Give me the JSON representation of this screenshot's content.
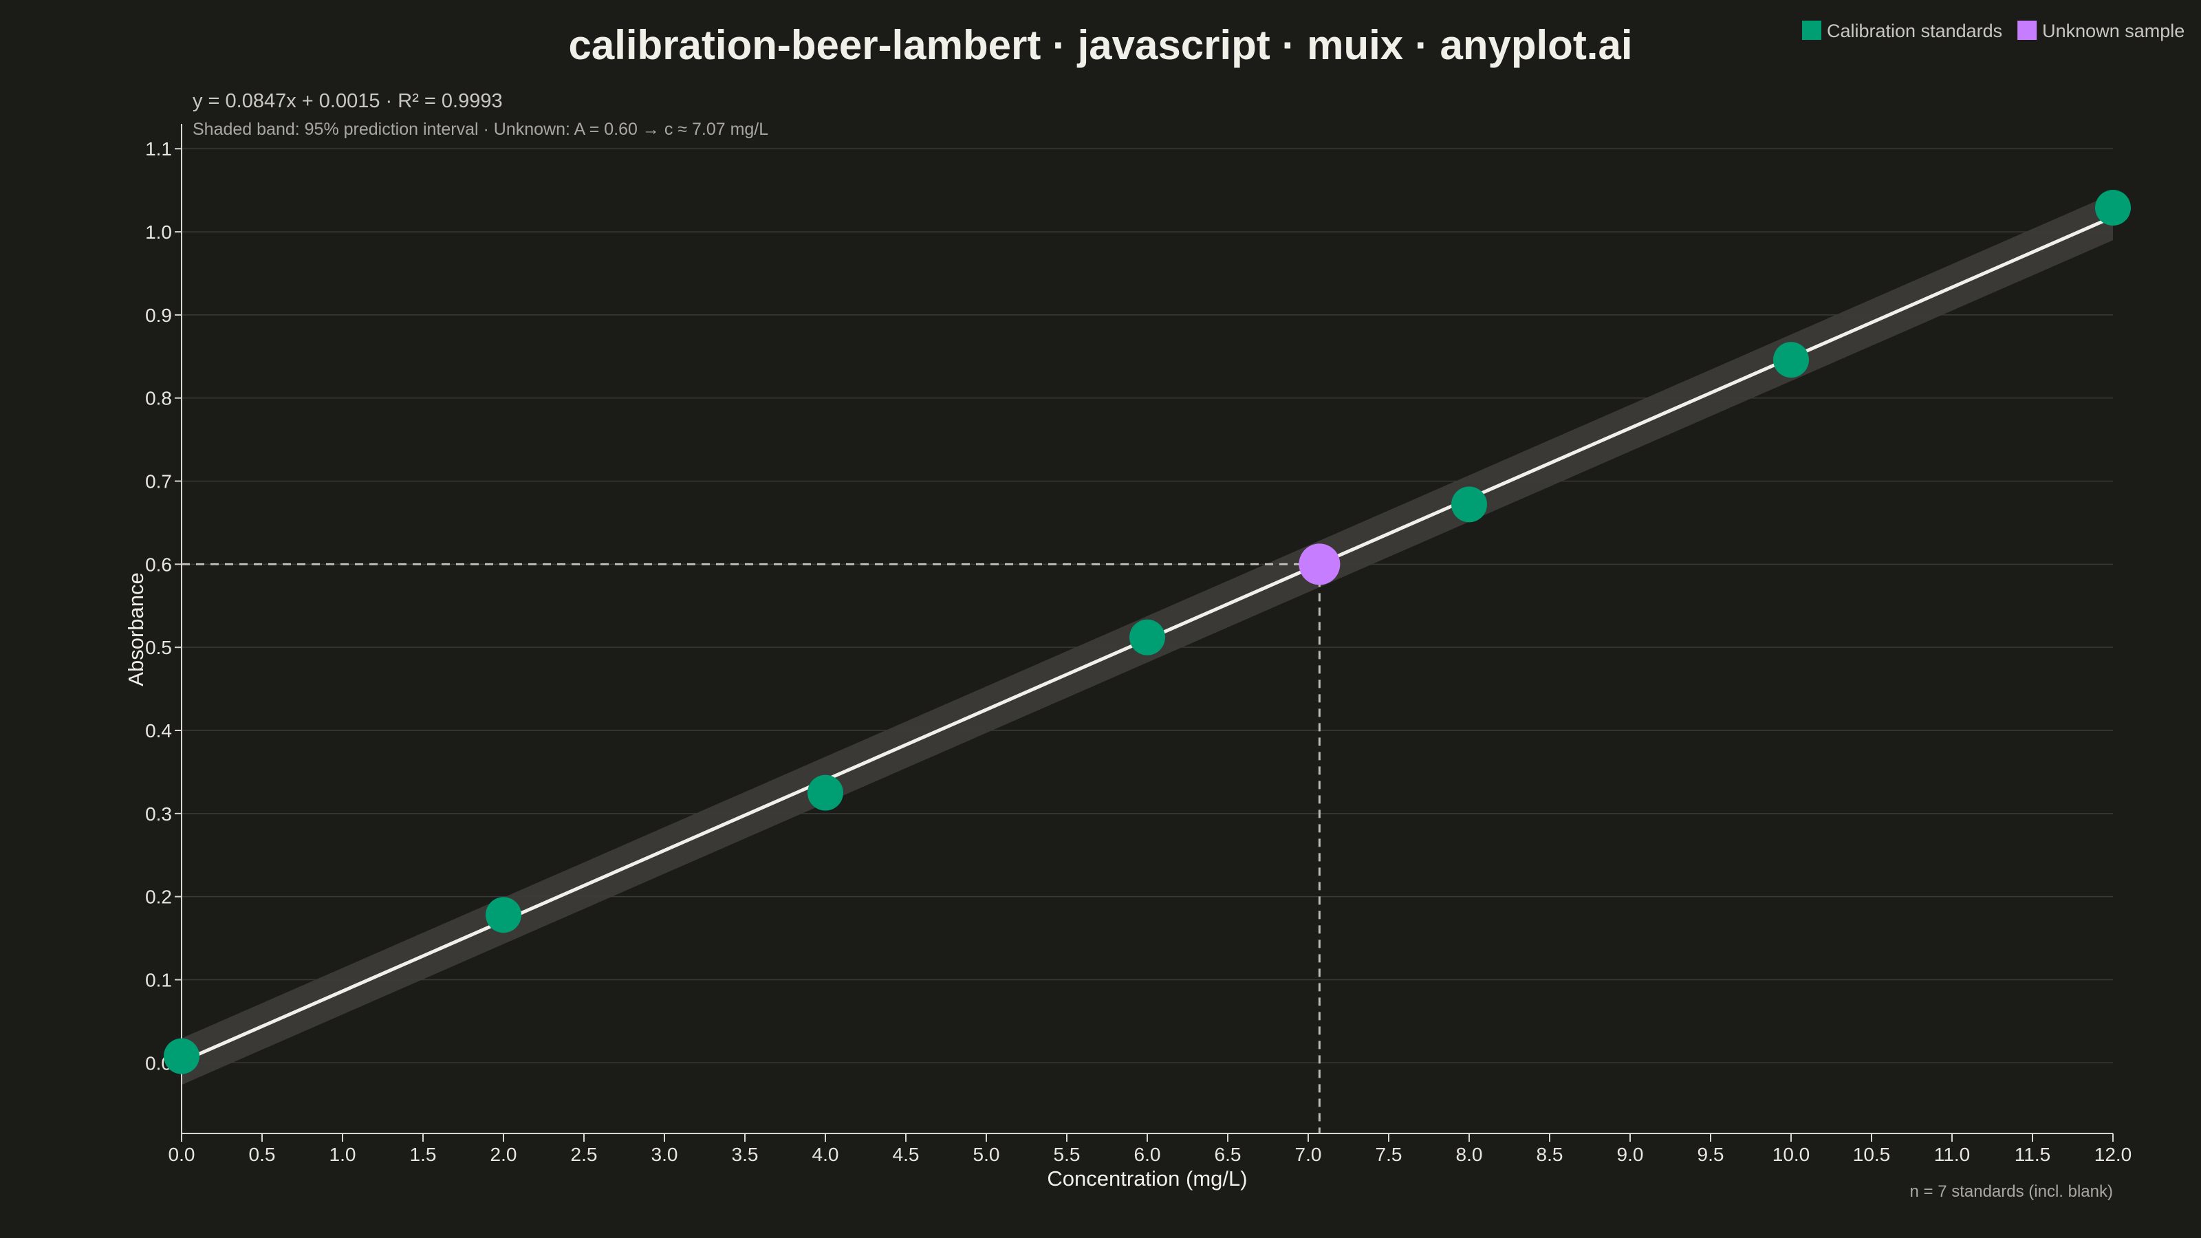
{
  "chart_data": {
    "type": "scatter",
    "title": "calibration-beer-lambert · javascript · muix · anyplot.ai",
    "equation_text": "y = 0.0847x + 0.0015 · R² = 0.9993",
    "subtitle": "Shaded band: 95% prediction interval · Unknown: A = 0.60 → c ≈ 7.07 mg/L",
    "xlabel": "Concentration (mg/L)",
    "ylabel": "Absorbance",
    "note": "n = 7 standards (incl. blank)",
    "xlim": [
      0,
      12
    ],
    "ylim": [
      -0.085,
      1.13
    ],
    "x_ticks": [
      0,
      0.5,
      1,
      1.5,
      2,
      2.5,
      3,
      3.5,
      4,
      4.5,
      5,
      5.5,
      6,
      6.5,
      7,
      7.5,
      8,
      8.5,
      9,
      9.5,
      10,
      10.5,
      11,
      11.5,
      12
    ],
    "x_tick_labels": [
      "0.0",
      "0.5",
      "1.0",
      "1.5",
      "2.0",
      "2.5",
      "3.0",
      "3.5",
      "4.0",
      "4.5",
      "5.0",
      "5.5",
      "6.0",
      "6.5",
      "7.0",
      "7.5",
      "8.0",
      "8.5",
      "9.0",
      "9.5",
      "10.0",
      "10.5",
      "11.0",
      "11.5",
      "12.0"
    ],
    "y_ticks": [
      0,
      0.1,
      0.2,
      0.3,
      0.4,
      0.5,
      0.6,
      0.7,
      0.8,
      0.9,
      1.0,
      1.1
    ],
    "y_tick_labels": [
      "0.0",
      "0.1",
      "0.2",
      "0.3",
      "0.4",
      "0.5",
      "0.6",
      "0.7",
      "0.8",
      "0.9",
      "1.0",
      "1.1"
    ],
    "grid": "horizontal",
    "legend_position": "top-right",
    "fit": {
      "slope": 0.0847,
      "intercept": 0.0015,
      "r2": 0.9993
    },
    "prediction_band_halfwidth": 0.028,
    "series": [
      {
        "name": "Calibration standards",
        "color": "#009e73",
        "points": [
          {
            "x": 0,
            "y": 0.008
          },
          {
            "x": 2,
            "y": 0.178
          },
          {
            "x": 4,
            "y": 0.325
          },
          {
            "x": 6,
            "y": 0.512
          },
          {
            "x": 8,
            "y": 0.672
          },
          {
            "x": 10,
            "y": 0.846
          },
          {
            "x": 12,
            "y": 1.029
          }
        ]
      },
      {
        "name": "Unknown sample",
        "color": "#c77dff",
        "points": [
          {
            "x": 7.07,
            "y": 0.6
          }
        ]
      }
    ],
    "colors": {
      "background": "#1b1b18",
      "grid": "#3a3a36",
      "band": "#3c3b37",
      "fit_line": "#f2f0ea",
      "guide_line": "#bdbbb4",
      "axis": "#d8d6cf"
    }
  }
}
